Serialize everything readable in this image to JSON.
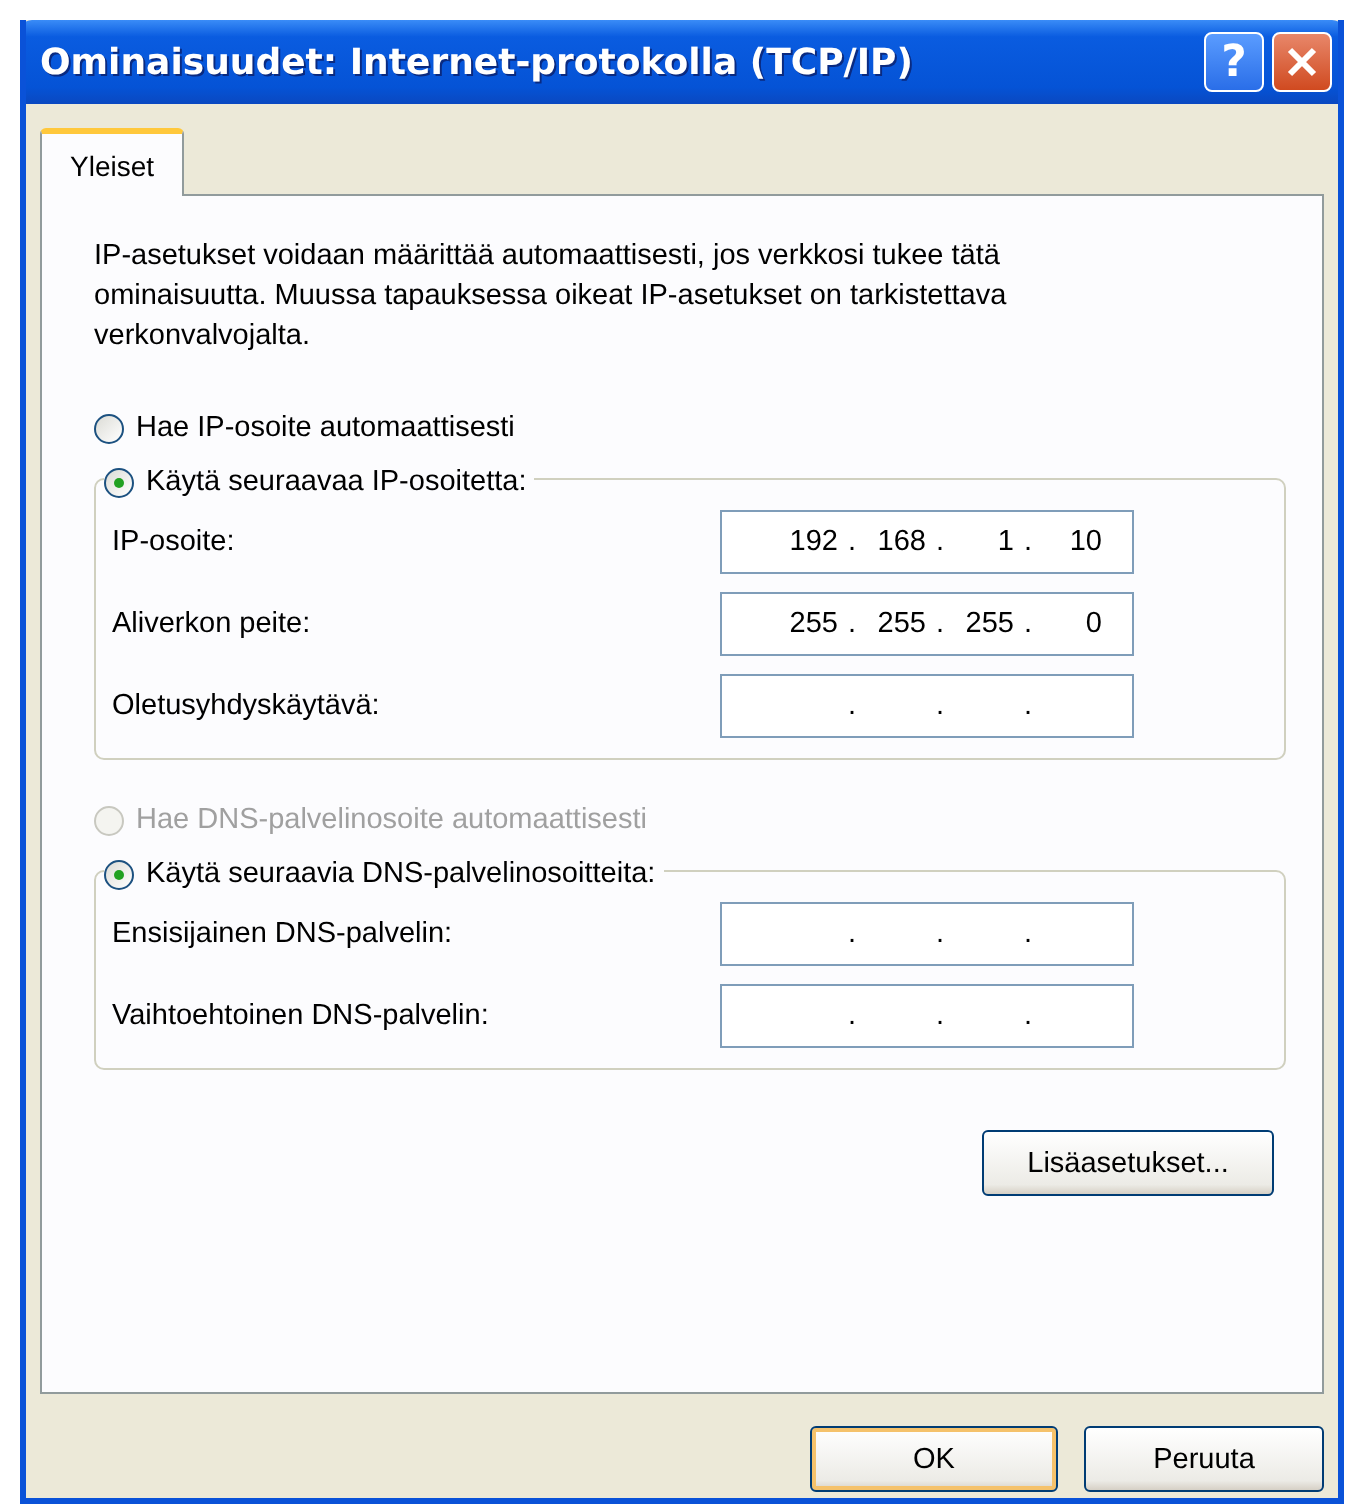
{
  "window": {
    "title": "Ominaisuudet: Internet-protokolla (TCP/IP)",
    "help_button": "?"
  },
  "tabs": [
    {
      "label": "Yleiset",
      "selected": true
    }
  ],
  "description": "IP-asetukset voidaan määrittää automaattisesti, jos verkkosi tukee tätä ominaisuutta. Muussa tapauksessa oikeat IP-asetukset on tarkistettava verkonvalvojalta.",
  "sections": [
    {
      "auto_option": {
        "label": "Hae IP-osoite automaattisesti",
        "selected": false,
        "disabled": false
      },
      "manual_option": {
        "label": "Käytä seuraavaa IP-osoitetta:",
        "selected": true,
        "disabled": false
      },
      "fields": [
        {
          "label": "IP-osoite:",
          "octets": [
            "192",
            "168",
            "1",
            "10"
          ],
          "dots": [
            ".",
            ".",
            "."
          ]
        },
        {
          "label": "Aliverkon peite:",
          "octets": [
            "255",
            "255",
            "255",
            "0"
          ],
          "dots": [
            ".",
            ".",
            "."
          ]
        },
        {
          "label": "Oletusyhdyskäytävä:",
          "dots": [
            ".",
            ".",
            "."
          ]
        }
      ]
    },
    {
      "auto_option": {
        "label": "Hae DNS-palvelinosoite automaattisesti",
        "selected": false,
        "disabled": true
      },
      "manual_option": {
        "label": "Käytä seuraavia DNS-palvelinosoitteita:",
        "selected": true,
        "disabled": false
      },
      "fields": [
        {
          "label": "Ensisijainen DNS-palvelin:",
          "dots": [
            ".",
            ".",
            "."
          ]
        },
        {
          "label": "Vaihtoehtoinen DNS-palvelin:",
          "dots": [
            ".",
            ".",
            "."
          ]
        }
      ]
    }
  ],
  "advanced_button": "Lisäasetukset...",
  "buttons": [
    {
      "label": "OK",
      "default": true
    },
    {
      "label": "Peruuta",
      "default": false
    }
  ]
}
